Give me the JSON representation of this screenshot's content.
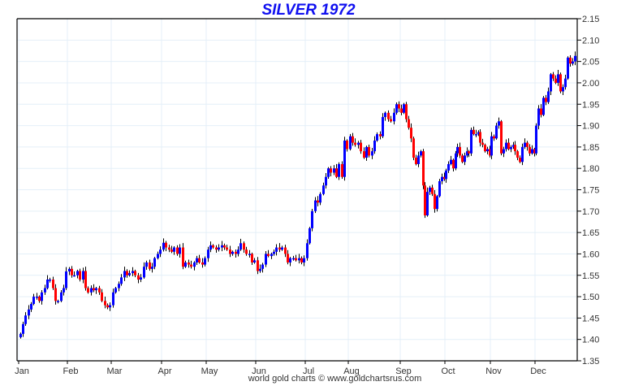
{
  "chart_data": {
    "type": "candlestick",
    "title": "SILVER 1972",
    "footer": "world gold charts © www.goldchartsrus.com",
    "xlabel": "",
    "ylabel": "",
    "ylim": [
      1.35,
      2.15
    ],
    "y_ticks": [
      "1.35",
      "1.40",
      "1.45",
      "1.50",
      "1.55",
      "1.60",
      "1.65",
      "1.70",
      "1.75",
      "1.80",
      "1.85",
      "1.90",
      "1.95",
      "2.00",
      "2.05",
      "2.10",
      "2.15"
    ],
    "y_axis_side": "right",
    "grid": true,
    "colors": {
      "up": "#0000ff",
      "down": "#ff0000",
      "wick": "#000000",
      "grid": "#e4eff8",
      "title": "#1010f0"
    },
    "months": [
      {
        "label": "Jan",
        "closes": [
          1.413,
          1.436,
          1.456,
          1.47,
          1.483,
          1.5,
          1.5,
          1.49,
          1.51,
          1.52,
          1.54,
          1.54,
          1.52,
          1.49,
          1.49,
          1.51,
          1.52,
          1.559
        ]
      },
      {
        "label": "Feb",
        "closes": [
          1.565,
          1.55,
          1.55,
          1.56,
          1.54,
          1.56,
          1.52,
          1.51,
          1.52,
          1.515,
          1.52,
          1.51,
          1.49,
          1.48,
          1.475,
          1.48
        ]
      },
      {
        "label": "Mar",
        "closes": [
          1.51,
          1.52,
          1.53,
          1.545,
          1.56,
          1.55,
          1.555,
          1.56,
          1.55,
          1.54,
          1.545,
          1.57,
          1.58,
          1.565,
          1.57,
          1.59,
          1.6,
          1.61
        ]
      },
      {
        "label": "Apr",
        "closes": [
          1.626,
          1.615,
          1.61,
          1.605,
          1.615,
          1.6,
          1.615,
          1.57,
          1.58,
          1.575,
          1.57,
          1.58,
          1.59,
          1.58,
          1.575,
          1.59
        ]
      },
      {
        "label": "May",
        "closes": [
          1.61,
          1.62,
          1.615,
          1.61,
          1.615,
          1.62,
          1.615,
          1.61,
          1.6,
          1.605,
          1.6,
          1.61,
          1.625,
          1.61,
          1.6,
          1.6,
          1.58,
          1.585
        ]
      },
      {
        "label": "Jun",
        "closes": [
          1.56,
          1.565,
          1.575,
          1.6,
          1.595,
          1.6,
          1.605,
          1.615,
          1.61,
          1.615,
          1.6,
          1.58,
          1.59,
          1.59,
          1.585,
          1.59,
          1.58,
          1.59
        ]
      },
      {
        "label": "Jul",
        "closes": [
          1.625,
          1.66,
          1.7,
          1.725,
          1.72,
          1.74,
          1.76,
          1.78,
          1.8,
          1.79,
          1.8,
          1.78,
          1.81,
          1.78,
          1.865,
          1.845
        ]
      },
      {
        "label": "Aug",
        "closes": [
          1.875,
          1.86,
          1.855,
          1.86,
          1.84,
          1.825,
          1.85,
          1.83,
          1.84,
          1.865,
          1.88,
          1.875,
          1.92,
          1.93,
          1.915,
          1.91,
          1.93,
          1.95,
          1.94
        ]
      },
      {
        "label": "Sep",
        "closes": [
          1.93,
          1.95,
          1.915,
          1.895,
          1.87,
          1.825,
          1.81,
          1.83,
          1.84,
          1.76,
          1.69,
          1.745,
          1.755,
          1.74,
          1.705,
          1.735,
          1.77,
          1.78,
          1.775
        ]
      },
      {
        "label": "Oct",
        "closes": [
          1.795,
          1.81,
          1.82,
          1.8,
          1.835,
          1.85,
          1.83,
          1.815,
          1.83,
          1.84,
          1.835,
          1.89,
          1.88,
          1.88,
          1.885,
          1.86,
          1.855,
          1.84,
          1.845,
          1.83
        ]
      },
      {
        "label": "Nov",
        "closes": [
          1.875,
          1.87,
          1.9,
          1.91,
          1.835,
          1.845,
          1.86,
          1.845,
          1.85,
          1.855,
          1.84,
          1.825,
          1.815,
          1.85,
          1.86,
          1.85,
          1.835,
          1.845,
          1.835
        ]
      },
      {
        "label": "Dec",
        "closes": [
          1.9,
          1.94,
          1.925,
          1.965,
          1.955,
          1.98,
          2.02,
          2.01,
          2.0,
          2.02,
          1.98,
          1.99,
          2.01,
          2.059,
          2.045,
          2.05,
          2.063
        ]
      }
    ]
  }
}
